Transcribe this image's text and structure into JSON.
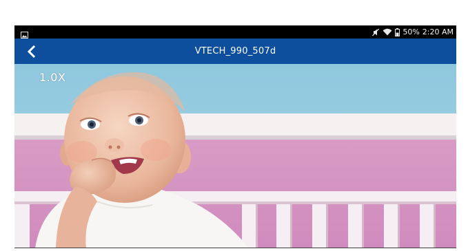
{
  "status_bar": {
    "battery": "50%",
    "time": "2:20 AM",
    "icons": [
      "image-notification-icon",
      "mute-icon",
      "wifi-icon",
      "battery-icon"
    ]
  },
  "app_bar": {
    "title": "VTECH_990_507d",
    "back_icon": "chevron-left-icon",
    "color": "#0d4f9d"
  },
  "video": {
    "zoom_label": "1.0X"
  }
}
